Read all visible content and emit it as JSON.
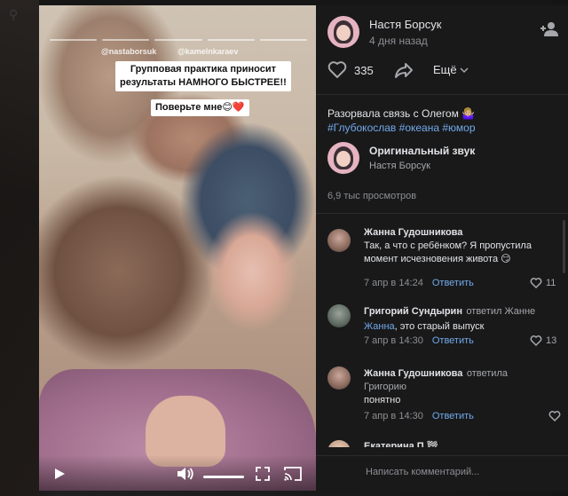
{
  "video": {
    "tag_left": "@nastaborsuk",
    "tag_right": "@kamelnkaraev",
    "caption_line1": "Групповая практика приносит",
    "caption_line2": "результаты НАМНОГО БЫСТРЕЕ!!",
    "caption_2": "Поверьте мне😊❤️",
    "volume_level": 1.0
  },
  "post": {
    "author_name": "Настя Борсук",
    "date": "4 дня назад",
    "likes": "335",
    "more_label": "Ещё",
    "text": "Разорвала связь с Олегом 🤷🏼‍♀️",
    "hashtags": [
      "#Глубокослав",
      "#океана",
      "#юмор"
    ],
    "sound_title": "Оригинальный звук",
    "sound_author": "Настя Борсук",
    "views": "6,9 тыс просмотров"
  },
  "comments": [
    {
      "author": "Жанна Гудошникова",
      "replied_text": "",
      "mention": "",
      "text_line1": "Так, а что с ребёнком? Я пропустила",
      "text_line2": "момент исчезновения живота 😏",
      "date": "7 апр в 14:24",
      "reply_label": "Ответить",
      "likes": "11"
    },
    {
      "author": "Григорий Сундырин",
      "replied_text": "ответил Жанне",
      "mention": "Жанна",
      "text_line1": ", это старый выпуск",
      "text_line2": "",
      "date": "7 апр в 14:30",
      "reply_label": "Ответить",
      "likes": "13"
    },
    {
      "author": "Жанна Гудошникова",
      "replied_text": "ответила",
      "replied_line2": "Григорию",
      "mention": "",
      "text_line1": "понятно",
      "text_line2": "",
      "date": "7 апр в 14:30",
      "reply_label": "Ответить",
      "likes": ""
    },
    {
      "author": "Екатерина П 🏁",
      "replied_text": "",
      "mention": "",
      "text_line1": "",
      "text_line2": "",
      "date": "",
      "reply_label": "",
      "likes": ""
    }
  ],
  "comment_box": {
    "placeholder": "Написать комментарий..."
  },
  "colors": {
    "accent": "#71aaeb",
    "panel_bg": "#19191a",
    "avatar_pink": "#e6b3c1"
  }
}
